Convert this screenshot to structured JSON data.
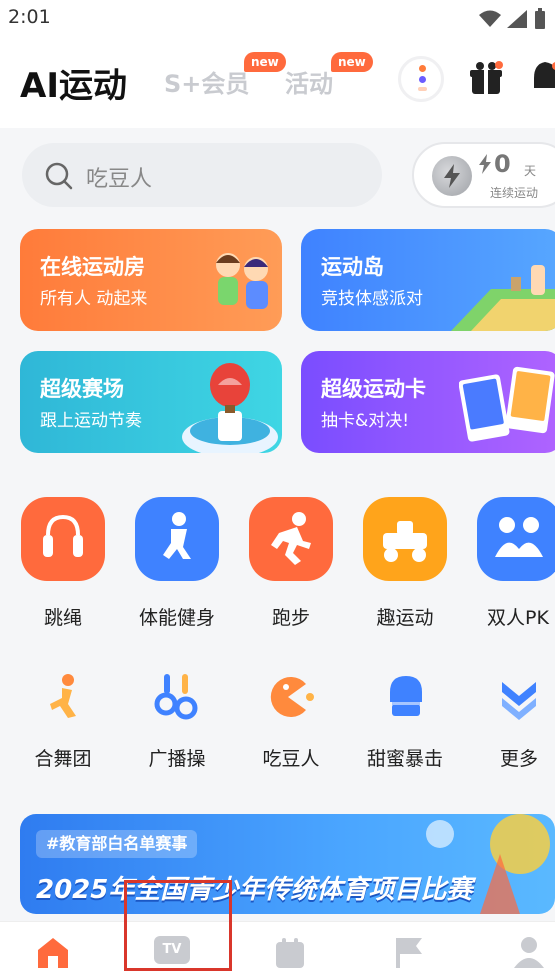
{
  "status_bar": {
    "time": "2:01"
  },
  "header": {
    "tabs": [
      {
        "label": "AI运动"
      },
      {
        "label": "S+会员",
        "badge": "new"
      },
      {
        "label": "活动",
        "badge": "new"
      }
    ]
  },
  "search": {
    "placeholder": "吃豆人"
  },
  "streak": {
    "count": "0",
    "unit": "天",
    "label": "连续运动"
  },
  "cards": [
    {
      "title": "在线运动房",
      "subtitle": "所有人 动起来"
    },
    {
      "title": "运动岛",
      "subtitle": "竞技体感派对"
    },
    {
      "title": "超级赛场",
      "subtitle": "跟上运动节奏"
    },
    {
      "title": "超级运动卡",
      "subtitle": "抽卡&对决!"
    }
  ],
  "grid_row1": [
    {
      "label": "跳绳",
      "icon": "jump-rope-icon",
      "color": "#ff6a3d"
    },
    {
      "label": "体能健身",
      "icon": "fitness-icon",
      "color": "#3f82ff"
    },
    {
      "label": "跑步",
      "icon": "running-icon",
      "color": "#ff6a3d"
    },
    {
      "label": "趣运动",
      "icon": "fun-sport-icon",
      "color": "#ffa41b"
    },
    {
      "label": "双人PK",
      "icon": "pk-icon",
      "color": "#3f82ff"
    }
  ],
  "grid_row2": [
    {
      "label": "合舞团",
      "icon": "dance-icon"
    },
    {
      "label": "广播操",
      "icon": "broadcast-exercise-icon"
    },
    {
      "label": "吃豆人",
      "icon": "pacman-icon"
    },
    {
      "label": "甜蜜暴击",
      "icon": "boxing-glove-icon"
    },
    {
      "label": "更多",
      "icon": "more-icon"
    }
  ],
  "banner": {
    "tag": "#教育部白名单赛事",
    "title": "2025年全国青少年传统体育项目比赛"
  },
  "bottom_nav": [
    {
      "icon": "home-icon",
      "label": "TV"
    }
  ],
  "colors": {
    "accent": "#ff6a3d",
    "blue": "#3f82ff"
  }
}
